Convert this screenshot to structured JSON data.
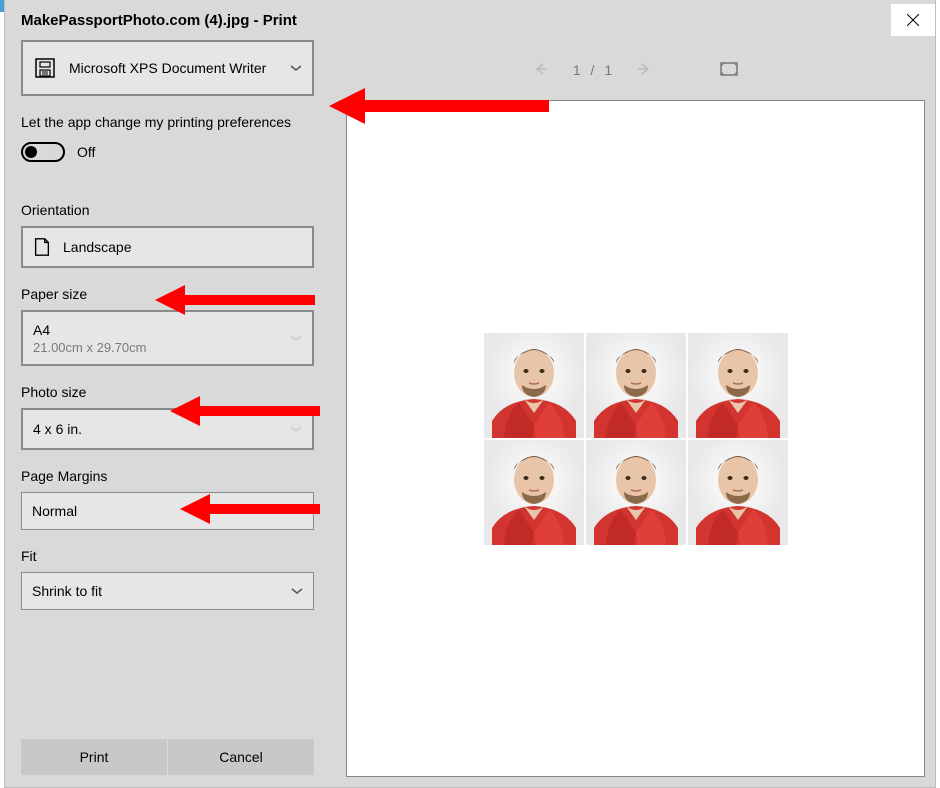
{
  "title": "MakePassportPhoto.com (4).jpg - Print",
  "printer": {
    "name": "Microsoft XPS Document Writer"
  },
  "preferences": {
    "label": "Let the app change my printing preferences",
    "toggle_value": "Off"
  },
  "orientation": {
    "label": "Orientation",
    "value": "Landscape"
  },
  "paper_size": {
    "label": "Paper size",
    "value": "A4",
    "dimensions": "21.00cm x 29.70cm"
  },
  "photo_size": {
    "label": "Photo size",
    "value": "4 x 6 in."
  },
  "page_margins": {
    "label": "Page Margins",
    "value": "Normal"
  },
  "fit": {
    "label": "Fit",
    "value": "Shrink to fit"
  },
  "buttons": {
    "print": "Print",
    "cancel": "Cancel"
  },
  "page_nav": {
    "current": "1",
    "separator": "/",
    "total": "1"
  }
}
